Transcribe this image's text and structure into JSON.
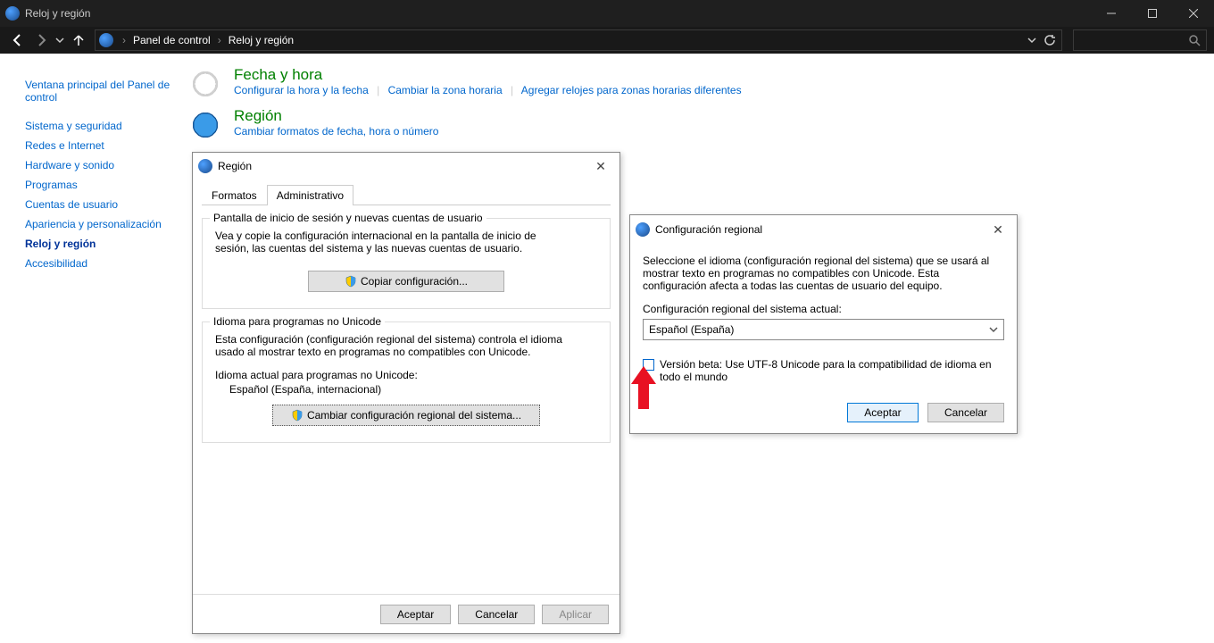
{
  "window": {
    "title": "Reloj y región"
  },
  "breadcrumbs": {
    "root": "Panel de control",
    "current": "Reloj y región"
  },
  "sidebar": {
    "header": "Ventana principal del Panel de control",
    "items": [
      "Sistema y seguridad",
      "Redes e Internet",
      "Hardware y sonido",
      "Programas",
      "Cuentas de usuario",
      "Apariencia y personalización",
      "Reloj y región",
      "Accesibilidad"
    ],
    "active_index": 6
  },
  "categories": {
    "datetime": {
      "title": "Fecha y hora",
      "links": [
        "Configurar la hora y la fecha",
        "Cambiar la zona horaria",
        "Agregar relojes para zonas horarias diferentes"
      ]
    },
    "region": {
      "title": "Región",
      "links": [
        "Cambiar formatos de fecha, hora o número"
      ]
    }
  },
  "region_dialog": {
    "title": "Región",
    "tabs": {
      "formats": "Formatos",
      "admin": "Administrativo"
    },
    "group1": {
      "title": "Pantalla de inicio de sesión y nuevas cuentas de usuario",
      "desc": "Vea y copie la configuración internacional en la pantalla de inicio de sesión, las cuentas del sistema y las nuevas cuentas de usuario.",
      "button": "Copiar configuración..."
    },
    "group2": {
      "title": "Idioma para programas no Unicode",
      "desc": "Esta configuración (configuración regional del sistema) controla el idioma usado al mostrar texto en programas no compatibles con Unicode.",
      "current_label": "Idioma actual para programas no Unicode:",
      "current_value": "Español (España, internacional)",
      "button": "Cambiar configuración regional del sistema..."
    },
    "buttons": {
      "ok": "Aceptar",
      "cancel": "Cancelar",
      "apply": "Aplicar"
    }
  },
  "locale_dialog": {
    "title": "Configuración regional",
    "desc": "Seleccione el idioma (configuración regional del sistema) que se usará al mostrar texto en programas no compatibles con Unicode. Esta configuración afecta a todas las cuentas de usuario del equipo.",
    "select_label": "Configuración regional del sistema actual:",
    "select_value": "Español (España)",
    "checkbox": "Versión beta: Use UTF-8 Unicode para la compatibilidad de idioma en todo el mundo",
    "ok": "Aceptar",
    "cancel": "Cancelar"
  }
}
